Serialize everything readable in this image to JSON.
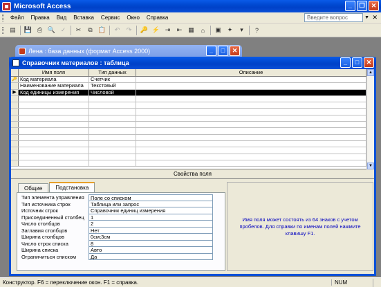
{
  "app": {
    "title": "Microsoft Access"
  },
  "menu": {
    "items": [
      "Файл",
      "Правка",
      "Вид",
      "Вставка",
      "Сервис",
      "Окно",
      "Справка"
    ],
    "help_placeholder": "Введите вопрос"
  },
  "db_window": {
    "title": "Лена : база данных (формат Access 2000)"
  },
  "table_window": {
    "title": "Справочник материалов : таблица",
    "columns": [
      "Имя поля",
      "Тип данных",
      "Описание"
    ],
    "rows": [
      {
        "key": true,
        "name": "Код материала",
        "type": "Счетчик",
        "description": ""
      },
      {
        "key": false,
        "name": "Наименование материала",
        "type": "Текстовый",
        "description": ""
      },
      {
        "key": false,
        "name": "Код единицы измерения",
        "type": "Числовой",
        "description": "",
        "current": true
      }
    ]
  },
  "properties": {
    "label": "Свойства поля",
    "tabs": [
      "Общие",
      "Подстановка"
    ],
    "active_tab": "Подстановка",
    "rows": [
      {
        "name": "Тип элемента управления",
        "value": "Поле со списком"
      },
      {
        "name": "Тип источника строк",
        "value": "Таблица или запрос"
      },
      {
        "name": "Источник строк",
        "value": "Справочник единиц измерения"
      },
      {
        "name": "Присоединенный столбец",
        "value": "1"
      },
      {
        "name": "Число столбцов",
        "value": "2"
      },
      {
        "name": "Заглавия столбцов",
        "value": "Нет"
      },
      {
        "name": "Ширина столбцов",
        "value": "0см;3см"
      },
      {
        "name": "Число строк списка",
        "value": "8"
      },
      {
        "name": "Ширина списка",
        "value": "Авто"
      },
      {
        "name": "Ограничиться списком",
        "value": "Да"
      }
    ],
    "help_text": "Имя поля может состоять из 64 знаков с учетом пробелов.  Для справки по именам полей нажмите клавишу F1."
  },
  "status": {
    "message": "Конструктор.  F6 = переключение окон.  F1 = справка.",
    "num": "NUM"
  }
}
